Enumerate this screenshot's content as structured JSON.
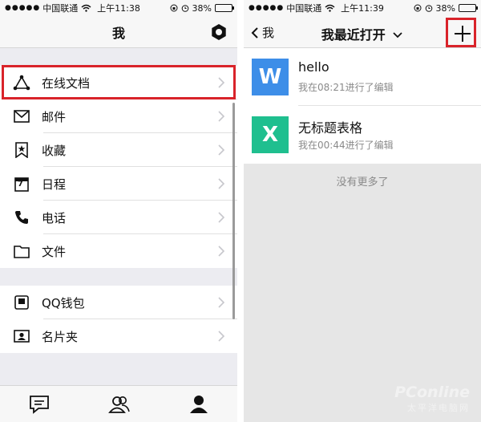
{
  "left": {
    "status": {
      "carrier": "中国联通",
      "time": "上午11:38",
      "battery": "38%",
      "battery_level": 0.38
    },
    "nav": {
      "title": "我"
    },
    "group1": [
      {
        "label": "在线文档",
        "icon": "triangle-nodes-icon"
      },
      {
        "label": "邮件",
        "icon": "mail-icon"
      },
      {
        "label": "收藏",
        "icon": "bookmark-star-icon"
      },
      {
        "label": "日程",
        "icon": "calendar-icon",
        "icon_text": "7"
      },
      {
        "label": "电话",
        "icon": "phone-icon"
      },
      {
        "label": "文件",
        "icon": "folder-icon"
      }
    ],
    "group2": [
      {
        "label": "QQ钱包",
        "icon": "wallet-icon"
      },
      {
        "label": "名片夹",
        "icon": "contact-card-icon"
      }
    ],
    "tabs": [
      "chat-icon",
      "contacts-icon",
      "profile-icon"
    ]
  },
  "right": {
    "status": {
      "carrier": "中国联通",
      "time": "上午11:39",
      "battery": "38%",
      "battery_level": 0.38
    },
    "nav": {
      "back": "我",
      "title": "我最近打开"
    },
    "docs": [
      {
        "name": "hello",
        "meta": "我在08:21进行了编辑",
        "badge": "W",
        "color": "#3d8ee8"
      },
      {
        "name": "无标题表格",
        "meta": "我在00:44进行了编辑",
        "badge": "X",
        "color": "#1fbf8f"
      }
    ],
    "empty": "没有更多了"
  },
  "watermark": {
    "brand": "PConline",
    "sub": "太平洋电脑网"
  },
  "colors": {
    "highlight": "#d9232a"
  }
}
